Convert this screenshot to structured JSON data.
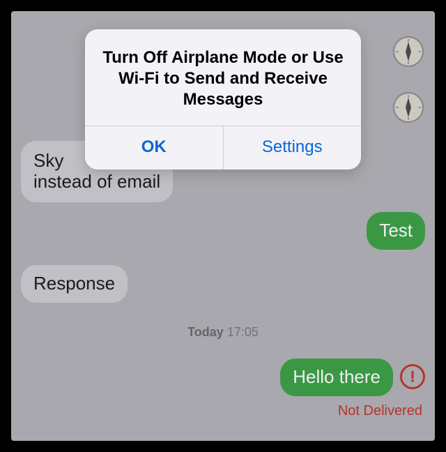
{
  "alert": {
    "title": "Turn Off Airplane Mode or Use Wi-Fi to Send and Receive Messages",
    "ok_label": "OK",
    "settings_label": "Settings"
  },
  "messages": {
    "incoming_partial_line1": "Sky",
    "incoming_partial_line2": "instead of email",
    "outgoing_test": "Test",
    "incoming_response": "Response",
    "outgoing_hello": "Hello there"
  },
  "timestamp": {
    "day": "Today",
    "time": "17:05"
  },
  "status": {
    "not_delivered": "Not Delivered"
  },
  "icons": {
    "compass": "compass-icon",
    "error": "error-icon"
  }
}
